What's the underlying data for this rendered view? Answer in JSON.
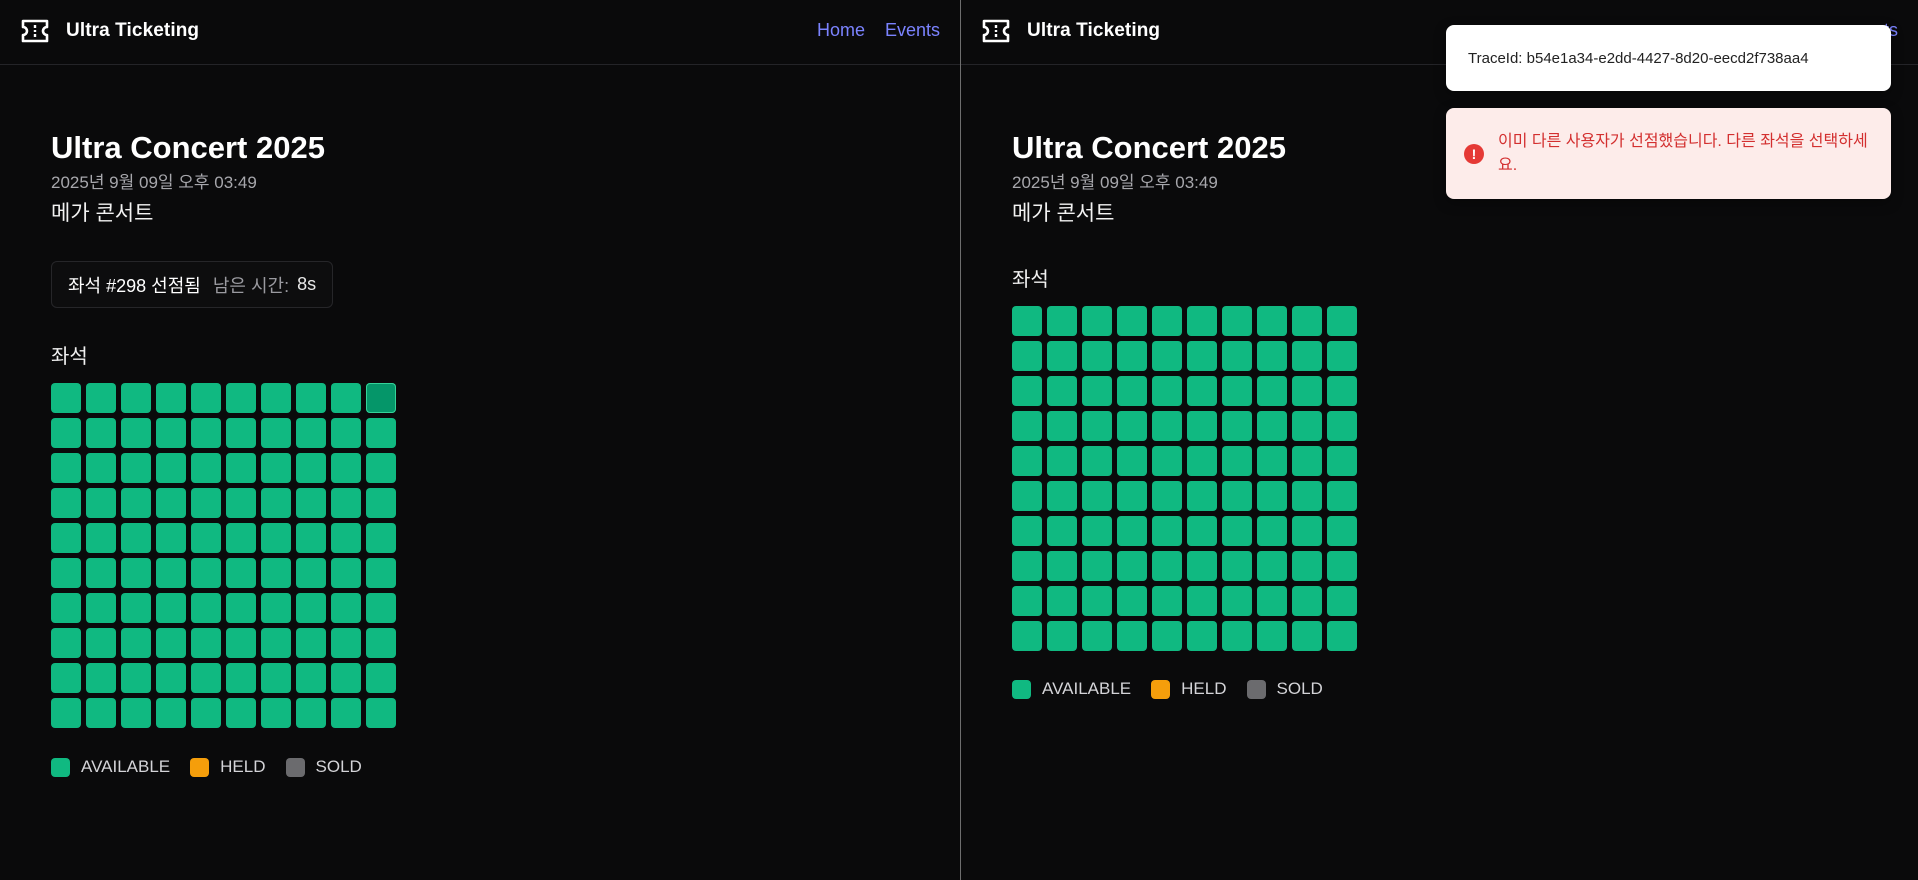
{
  "app": {
    "name": "Ultra Ticketing"
  },
  "nav": {
    "home": "Home",
    "events": "Events",
    "events_clipped": "ts"
  },
  "event": {
    "title": "Ultra Concert 2025",
    "datetime": "2025년 9월 09일 오후 03:49",
    "subtitle": "메가 콘서트"
  },
  "hold": {
    "seat_text": "좌석 #298 선점됨",
    "time_label": "남은 시간:",
    "time_value": "8s"
  },
  "seats": {
    "section_label": "좌석",
    "rows": 10,
    "cols": 10,
    "selected_index_left": 9
  },
  "legend": [
    {
      "label": "AVAILABLE",
      "color": "#10b981"
    },
    {
      "label": "HELD",
      "color": "#f59e0b"
    },
    {
      "label": "SOLD",
      "color": "#6b6b6e"
    }
  ],
  "colors": {
    "accent_link": "#7b83ff",
    "seat_available": "#10b981",
    "seat_selected": "#059669",
    "error_text": "#d32f2f"
  },
  "toasts": {
    "trace": "TraceId: b54e1a34-e2dd-4427-8d20-eecd2f738aa4",
    "error": "이미 다른 사용자가 선점했습니다. 다른 좌석을 선택하세요."
  }
}
